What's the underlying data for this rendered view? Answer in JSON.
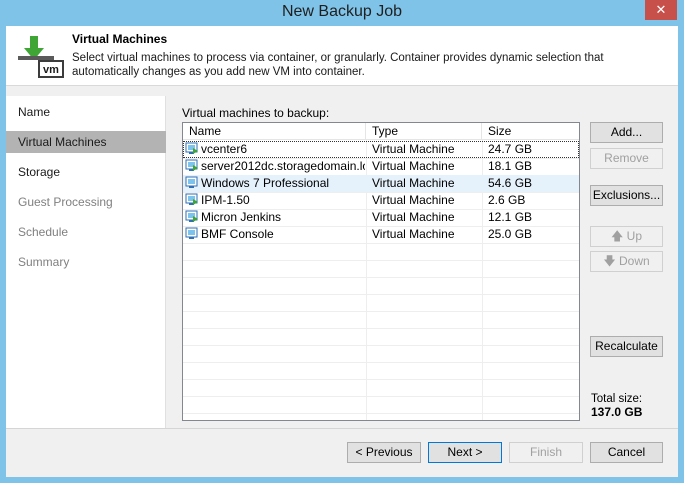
{
  "window": {
    "title": "New Backup Job",
    "close_glyph": "✕"
  },
  "header": {
    "title": "Virtual Machines",
    "description": "Select virtual machines to process via container, or granularly. Container provides dynamic selection that automatically changes as you add new VM into container.",
    "icon": "vm-download-icon"
  },
  "nav": {
    "items": [
      {
        "label": "Name",
        "state": "normal"
      },
      {
        "label": "Virtual Machines",
        "state": "active"
      },
      {
        "label": "Storage",
        "state": "normal"
      },
      {
        "label": "Guest Processing",
        "state": "disabled"
      },
      {
        "label": "Schedule",
        "state": "disabled"
      },
      {
        "label": "Summary",
        "state": "disabled"
      }
    ]
  },
  "vms": {
    "label": "Virtual machines to backup:",
    "columns": [
      "Name",
      "Type",
      "Size"
    ],
    "rows": [
      {
        "name": "vcenter6",
        "type": "Virtual Machine",
        "size": "24.7 GB",
        "icon": "vm-running-icon"
      },
      {
        "name": "server2012dc.storagedomain.lo...",
        "type": "Virtual Machine",
        "size": "18.1 GB",
        "icon": "vm-running-icon"
      },
      {
        "name": "Windows 7 Professional",
        "type": "Virtual Machine",
        "size": "54.6 GB",
        "icon": "vm-icon"
      },
      {
        "name": "IPM-1.50",
        "type": "Virtual Machine",
        "size": "2.6 GB",
        "icon": "vm-running-icon"
      },
      {
        "name": "Micron Jenkins",
        "type": "Virtual Machine",
        "size": "12.1 GB",
        "icon": "vm-running-icon"
      },
      {
        "name": "BMF Console",
        "type": "Virtual Machine",
        "size": "25.0 GB",
        "icon": "vm-icon"
      }
    ]
  },
  "side_buttons": {
    "add": "Add...",
    "remove": "Remove",
    "exclusions": "Exclusions...",
    "up": "Up",
    "down": "Down",
    "recalculate": "Recalculate"
  },
  "total": {
    "label": "Total size:",
    "value": "137.0 GB"
  },
  "footer": {
    "previous": "< Previous",
    "next": "Next >",
    "finish": "Finish",
    "cancel": "Cancel"
  },
  "colors": {
    "titlebar": "#7fc3e8",
    "close": "#c7504a",
    "active_nav": "#b3b3b3",
    "selected_row": "#e5f1fb"
  }
}
